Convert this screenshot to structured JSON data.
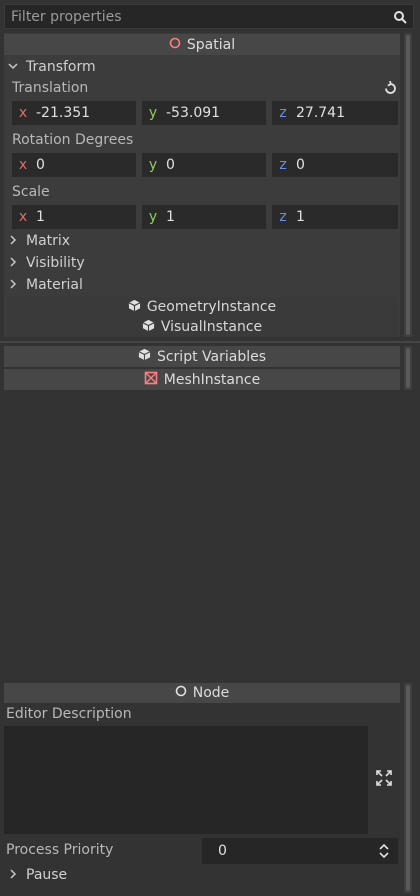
{
  "filter": {
    "placeholder": "Filter properties"
  },
  "spatial": {
    "title": "Spatial",
    "icon": "spatial-node-icon"
  },
  "transform": {
    "label": "Transform",
    "translation": {
      "label": "Translation",
      "x": "-21.351",
      "y": "-53.091",
      "z": "27.741"
    },
    "rotation": {
      "label": "Rotation Degrees",
      "x": "0",
      "y": "0",
      "z": "0"
    },
    "scale": {
      "label": "Scale",
      "x": "1",
      "y": "1",
      "z": "1"
    }
  },
  "axes": {
    "x": "x",
    "y": "y",
    "z": "z"
  },
  "axis_colors": {
    "x": "#e06b6b",
    "y": "#8fce5a",
    "z": "#6a8fe8"
  },
  "folds": {
    "matrix": "Matrix",
    "visibility": "Visibility",
    "material": "Material"
  },
  "geometry_instance": "GeometryInstance",
  "visual_instance": "VisualInstance",
  "script_variables": "Script Variables",
  "mesh_instance": "MeshInstance",
  "node": {
    "title": "Node"
  },
  "editor_description": {
    "label": "Editor Description",
    "value": ""
  },
  "process_priority": {
    "label": "Process Priority",
    "value": "0"
  },
  "pause": {
    "label": "Pause"
  },
  "colors": {
    "background": "#333333",
    "header": "#474747",
    "field": "#2a2a2a",
    "accent_spatial": "#fc7f7f",
    "accent_mesh": "#fc7f7f"
  }
}
